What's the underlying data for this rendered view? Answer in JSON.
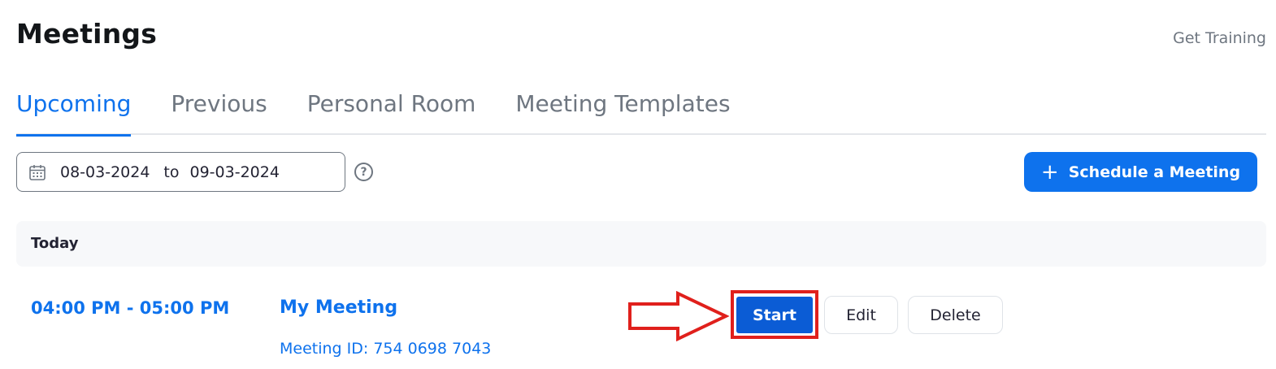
{
  "header": {
    "title": "Meetings",
    "get_training": "Get Training"
  },
  "tabs": [
    {
      "label": "Upcoming",
      "active": true
    },
    {
      "label": "Previous",
      "active": false
    },
    {
      "label": "Personal Room",
      "active": false
    },
    {
      "label": "Meeting Templates",
      "active": false
    }
  ],
  "filter": {
    "from_date": "08-03-2024",
    "to_label": "to",
    "to_date": "09-03-2024",
    "calendar_icon": "calendar-icon",
    "help_icon": "question-circle-icon",
    "help_glyph": "?"
  },
  "actions": {
    "schedule_icon": "plus-icon",
    "schedule_glyph": "+",
    "schedule_label": "Schedule a Meeting"
  },
  "sections": [
    {
      "heading": "Today",
      "meetings": [
        {
          "time": "04:00 PM - 05:00 PM",
          "name": "My Meeting",
          "meeting_id": "Meeting ID: 754 0698 7043",
          "start_label": "Start",
          "edit_label": "Edit",
          "delete_label": "Delete"
        }
      ]
    }
  ],
  "annotation": {
    "arrow_icon": "right-arrow-outline-icon",
    "highlight_color": "#e0201c"
  },
  "colors": {
    "accent": "#0e72ed",
    "start_button": "#0b5cd5",
    "muted_text": "#6e7680"
  }
}
